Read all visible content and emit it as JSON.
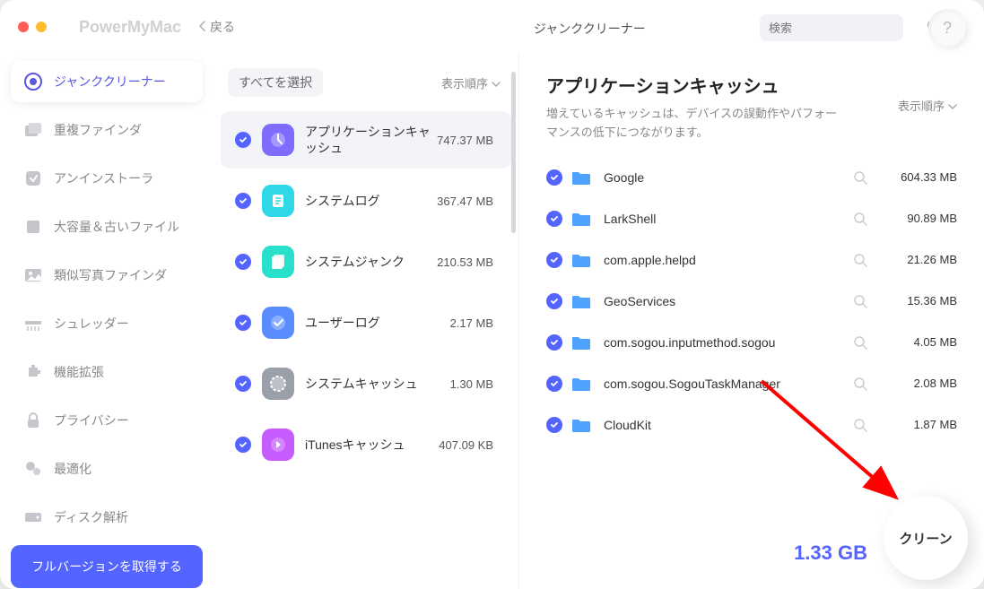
{
  "app_title": "PowerMyMac",
  "back_label": "戻る",
  "mid_header_title": "ジャンククリーナー",
  "search_placeholder": "検索",
  "sidebar": {
    "items": [
      {
        "label": "ジャンククリーナー"
      },
      {
        "label": "重複ファインダ"
      },
      {
        "label": "アンインストーラ"
      },
      {
        "label": "大容量＆古いファイル"
      },
      {
        "label": "類似写真ファインダ"
      },
      {
        "label": "シュレッダー"
      },
      {
        "label": "機能拡張"
      },
      {
        "label": "プライバシー"
      },
      {
        "label": "最適化"
      },
      {
        "label": "ディスク解析"
      }
    ],
    "full_version": "フルバージョンを取得する"
  },
  "middle": {
    "select_all": "すべてを選択",
    "sort": "表示順序",
    "categories": [
      {
        "name": "アプリケーションキャッシュ",
        "size": "747.37 MB",
        "icon_bg": "#7e6cff"
      },
      {
        "name": "システムログ",
        "size": "367.47 MB",
        "icon_bg": "#2ed8e6"
      },
      {
        "name": "システムジャンク",
        "size": "210.53 MB",
        "icon_bg": "#28e0cc"
      },
      {
        "name": "ユーザーログ",
        "size": "2.17 MB",
        "icon_bg": "#5a8cff"
      },
      {
        "name": "システムキャッシュ",
        "size": "1.30 MB",
        "icon_bg": "#9aa0aa"
      },
      {
        "name": "iTunesキャッシュ",
        "size": "407.09 KB",
        "icon_bg": "#c65cff"
      }
    ]
  },
  "right": {
    "title": "アプリケーションキャッシュ",
    "description": "増えているキャッシュは、デバイスの誤動作やパフォーマンスの低下につながります。",
    "sort": "表示順序",
    "files": [
      {
        "name": "Google",
        "size": "604.33 MB"
      },
      {
        "name": "LarkShell",
        "size": "90.89 MB"
      },
      {
        "name": "com.apple.helpd",
        "size": "21.26 MB"
      },
      {
        "name": "GeoServices",
        "size": "15.36 MB"
      },
      {
        "name": "com.sogou.inputmethod.sogou",
        "size": "4.05 MB"
      },
      {
        "name": "com.sogou.SogouTaskManager",
        "size": "2.08 MB"
      },
      {
        "name": "CloudKit",
        "size": "1.87 MB"
      }
    ],
    "total": "1.33 GB",
    "clean": "クリーン"
  }
}
